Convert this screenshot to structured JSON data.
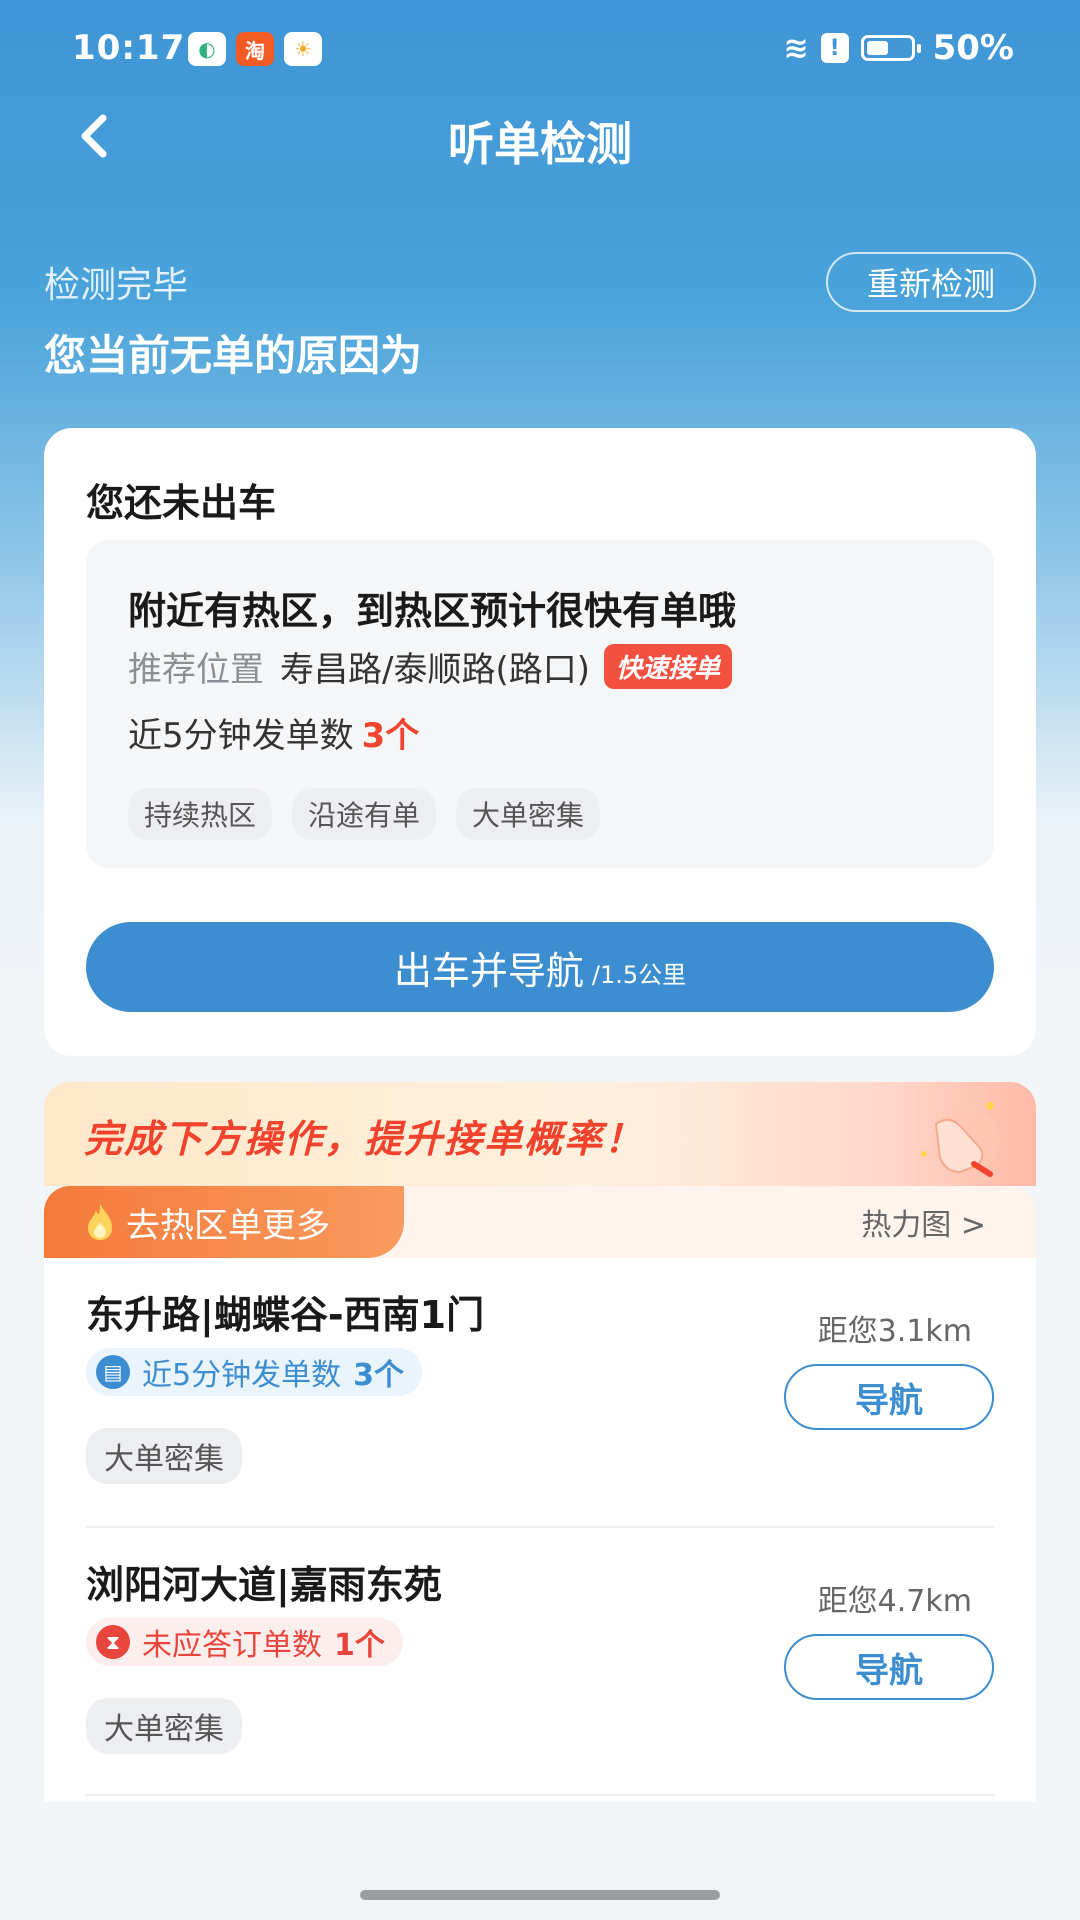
{
  "status_bar": {
    "time": "10:17",
    "app_icons": [
      "wechat-icon",
      "taobao-icon",
      "weather-icon"
    ],
    "taobao_char": "淘",
    "battery": "50%"
  },
  "header": {
    "title": "听单检测"
  },
  "result": {
    "status": "检测完毕",
    "reason_title": "您当前无单的原因为",
    "retest_label": "重新检测"
  },
  "card": {
    "title": "您还未出车",
    "headline": "附近有热区，到热区预计很快有单哦",
    "loc_label": "推荐位置",
    "loc_value": "寿昌路/泰顺路(路口)",
    "badge": "快速接单",
    "count_label": "近5分钟发单数",
    "count_value": "3个",
    "tags": [
      "持续热区",
      "沿途有单",
      "大单密集"
    ],
    "go_label": "出车并导航",
    "go_distance": "/1.5公里"
  },
  "promo": {
    "text": "完成下方操作，提升接单概率！"
  },
  "hotzone": {
    "tab_label": "去热区单更多",
    "heatmap_label": "热力图 >",
    "items": [
      {
        "name": "东升路|蝴蝶谷-西南1门",
        "metric_label": "近5分钟发单数",
        "metric_value": "3个",
        "tag": "大单密集",
        "distance": "距您3.1km",
        "nav_label": "导航"
      },
      {
        "name": "浏阳河大道|嘉雨东苑",
        "metric_label": "未应答订单数",
        "metric_value": "1个",
        "tag": "大单密集",
        "distance": "距您4.7km",
        "nav_label": "导航"
      }
    ]
  },
  "colors": {
    "primary_blue": "#3d8ed0",
    "alert_red": "#f0452f",
    "hot_orange": "#f47a3a"
  }
}
